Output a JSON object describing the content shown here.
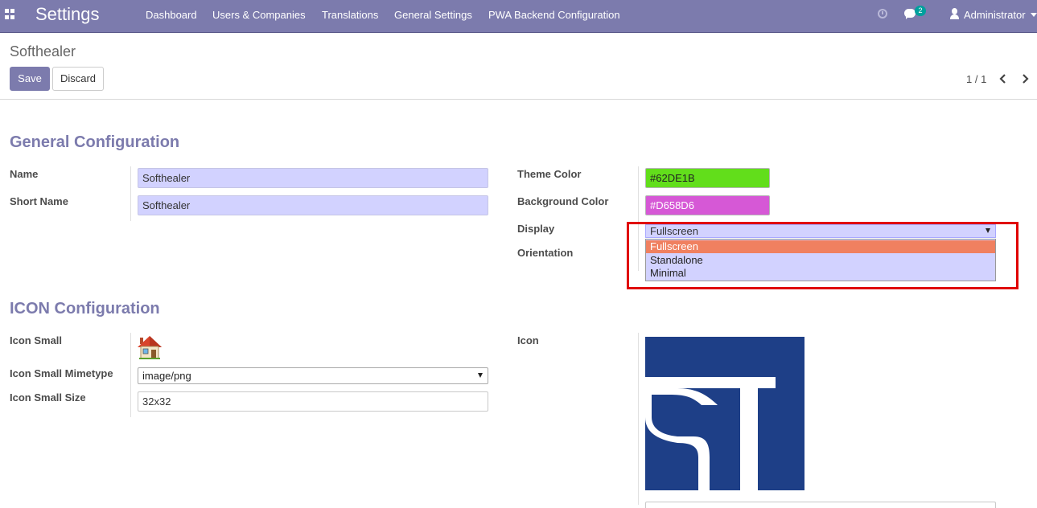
{
  "navbar": {
    "brand": "Settings",
    "menu": [
      "Dashboard",
      "Users & Companies",
      "Translations",
      "General Settings",
      "PWA Backend Configuration"
    ],
    "chat_count": "2",
    "user": "Administrator",
    "icons": {
      "apps": "apps-grid-icon",
      "clock": "clock-icon",
      "chat": "chat-icon",
      "user": "user-icon"
    }
  },
  "control_panel": {
    "breadcrumb": "Softhealer",
    "save_label": "Save",
    "discard_label": "Discard",
    "pager": "1 / 1"
  },
  "general": {
    "title": "General Configuration",
    "name_label": "Name",
    "name_value": "Softhealer",
    "short_name_label": "Short Name",
    "short_name_value": "Softhealer",
    "theme_color_label": "Theme Color",
    "theme_color_value": "#62DE1B",
    "background_color_label": "Background Color",
    "background_color_value": "#D658D6",
    "display_label": "Display",
    "display_value": "Fullscreen",
    "display_options": [
      "Fullscreen",
      "Standalone",
      "Minimal"
    ],
    "orientation_label": "Orientation"
  },
  "icon": {
    "title": "ICON Configuration",
    "icon_small_label": "Icon Small",
    "mimetype_label": "Icon Small Mimetype",
    "mimetype_value": "image/png",
    "size_label": "Icon Small Size",
    "size_value": "32x32",
    "icon_label": "Icon"
  },
  "colors": {
    "accent": "#7c7bad",
    "theme_color": "#62DE1B",
    "background_color": "#D658D6",
    "field_bg": "#d2d2ff",
    "option_active": "#f08060",
    "highlight": "#e00000",
    "logo_blue": "#1e3f87"
  }
}
